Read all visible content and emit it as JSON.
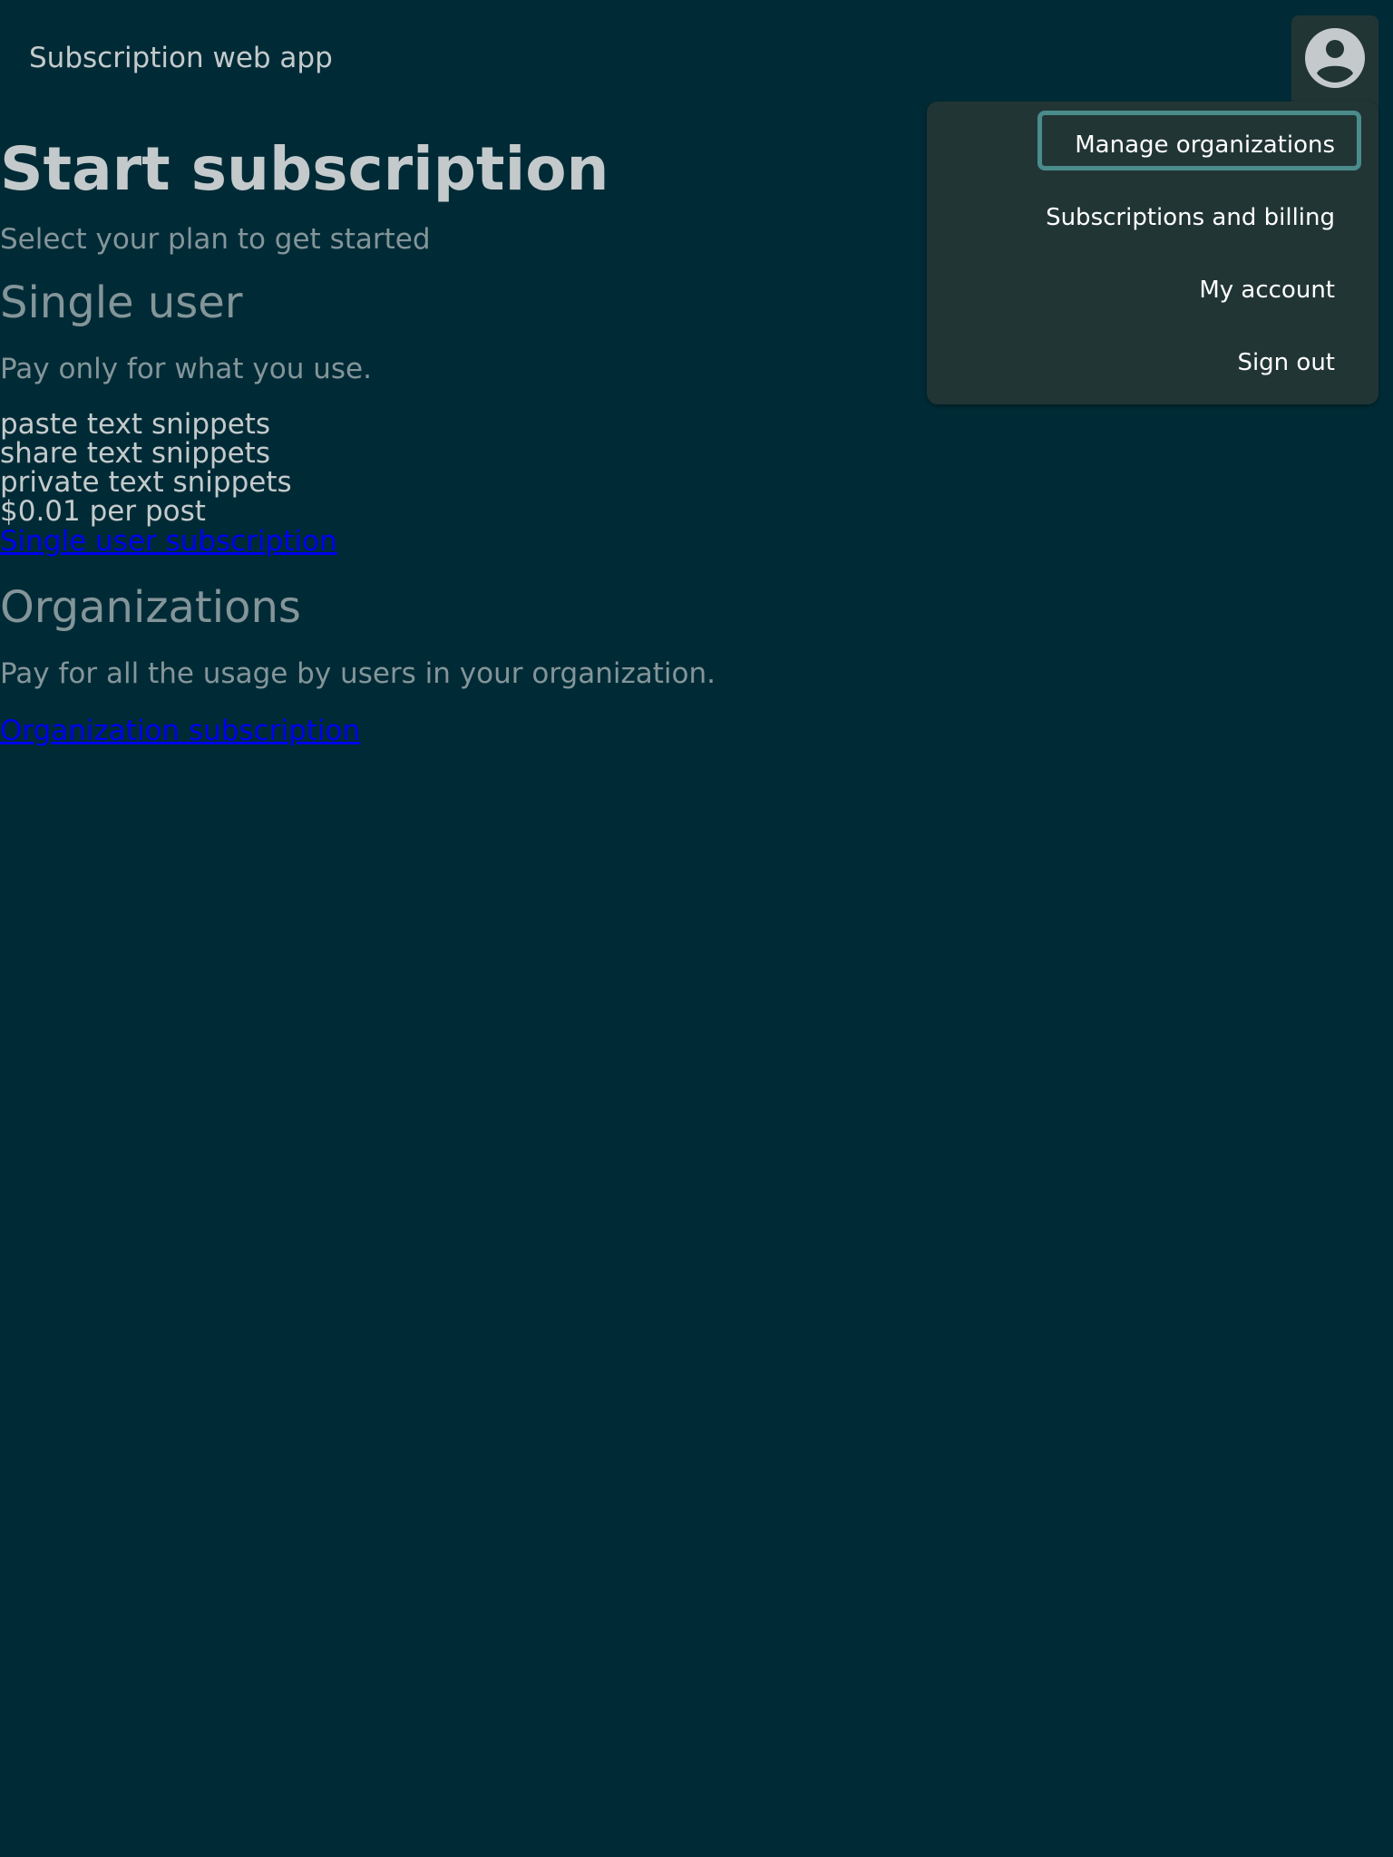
{
  "header": {
    "app_title": "Subscription web app",
    "avatar_icon": "account-circle-icon"
  },
  "user_menu": {
    "items": [
      {
        "label": "Manage organizations",
        "focused": true
      },
      {
        "label": "Subscriptions and billing"
      },
      {
        "label": "My account"
      },
      {
        "label": "Sign out"
      }
    ]
  },
  "main": {
    "title": "Start subscription",
    "subtitle": "Select your plan to get started",
    "single_user": {
      "heading": "Single user",
      "description": "Pay only for what you use.",
      "features": [
        "paste text snippets",
        "share text snippets",
        "private text snippets",
        "$0.01 per post"
      ],
      "link_label": "Single user subscription"
    },
    "organizations": {
      "heading": "Organizations",
      "description": "Pay for all the usage by users in your organization.",
      "link_label": "Organization subscription"
    }
  },
  "colors": {
    "background": "#002b36",
    "menu_background": "#223535",
    "focus_ring": "#4a8b8c",
    "link": "#0000ee",
    "text_primary": "#c4cacc",
    "text_muted": "#84959a"
  }
}
